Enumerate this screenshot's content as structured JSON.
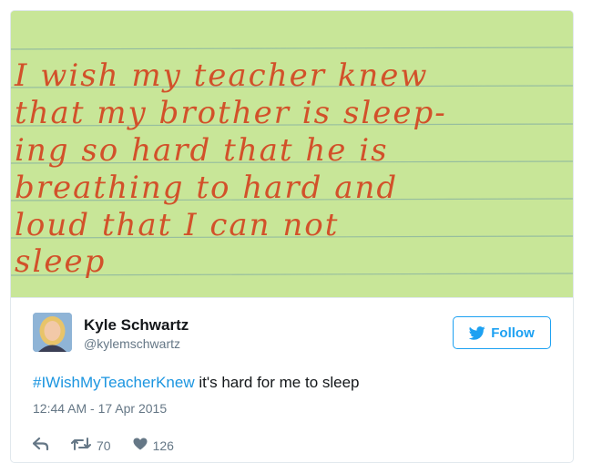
{
  "tweet": {
    "photo": {
      "description_lines": [
        "I wish my teacher knew",
        "that my brother is sleep-",
        "ing so hard that he is",
        "breathing to hard and",
        "loud that I can not",
        "sleep"
      ],
      "paper_color": "#c8e698",
      "rule_color": "#8fb8a0",
      "ink_color": "#d2512a"
    },
    "author": {
      "name": "Kyle Schwartz",
      "handle": "@kylemschwartz"
    },
    "follow_label": "Follow",
    "text": {
      "hashtag": "#IWishMyTeacherKnew",
      "body": " it's hard for me to sleep"
    },
    "timestamp": "12:44 AM - 17 Apr 2015",
    "retweet_count": "70",
    "like_count": "126"
  },
  "colors": {
    "accent": "#1da1f2",
    "hashtag": "#1b95e0",
    "text": "#14171a",
    "muted": "#657786",
    "border": "#e1e8ed"
  },
  "icons": {
    "reply": "reply-icon",
    "retweet": "retweet-icon",
    "like": "heart-icon",
    "follow": "twitter-bird-icon"
  }
}
